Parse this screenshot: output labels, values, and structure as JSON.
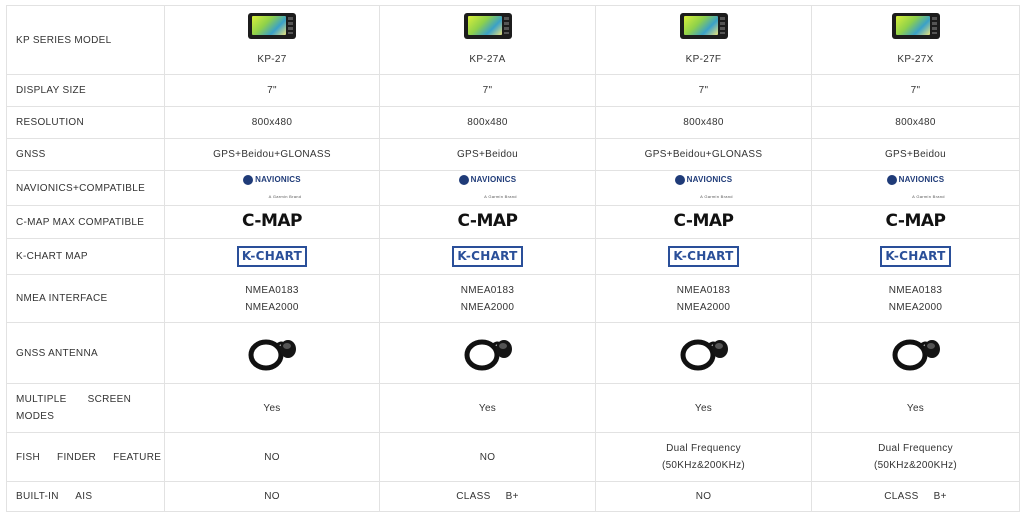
{
  "labels": {
    "model": "KP SERIES MODEL",
    "display_size": "DISPLAY SIZE",
    "resolution": "RESOLUTION",
    "gnss": "GNSS",
    "navionics": "NAVIONICS+COMPATIBLE",
    "cmap": "C-MAP MAX COMPATIBLE",
    "kchart": "K-CHART MAP",
    "nmea": "NMEA INTERFACE",
    "antenna": "GNSS ANTENNA",
    "multi_screen": "MULTIPLE SCREEN MODES",
    "fish_finder": "FISH FINDER FEATURE",
    "ais": "BUILT-IN AIS"
  },
  "logos": {
    "navionics_word": "NAVIONICS",
    "navionics_sub": "A Garmin Brand",
    "cmap": "C-MAP",
    "kchart": "K-CHART"
  },
  "models": [
    {
      "name": "KP-27",
      "display_size": "7\"",
      "resolution": "800x480",
      "gnss": "GPS+Beidou+GLONASS",
      "nmea1": "NMEA0183",
      "nmea2": "NMEA2000",
      "multi_screen": "Yes",
      "fish1": "NO",
      "fish2": "",
      "ais": "NO"
    },
    {
      "name": "KP-27A",
      "display_size": "7\"",
      "resolution": "800x480",
      "gnss": "GPS+Beidou",
      "nmea1": "NMEA0183",
      "nmea2": "NMEA2000",
      "multi_screen": "Yes",
      "fish1": "NO",
      "fish2": "",
      "ais": "CLASS B+"
    },
    {
      "name": "KP-27F",
      "display_size": "7\"",
      "resolution": "800x480",
      "gnss": "GPS+Beidou+GLONASS",
      "nmea1": "NMEA0183",
      "nmea2": "NMEA2000",
      "multi_screen": "Yes",
      "fish1": "Dual Frequency",
      "fish2": "(50KHz&200KHz)",
      "ais": "NO"
    },
    {
      "name": "KP-27X",
      "display_size": "7\"",
      "resolution": "800x480",
      "gnss": "GPS+Beidou",
      "nmea1": "NMEA0183",
      "nmea2": "NMEA2000",
      "multi_screen": "Yes",
      "fish1": "Dual Frequency",
      "fish2": "(50KHz&200KHz)",
      "ais": "CLASS B+"
    }
  ]
}
